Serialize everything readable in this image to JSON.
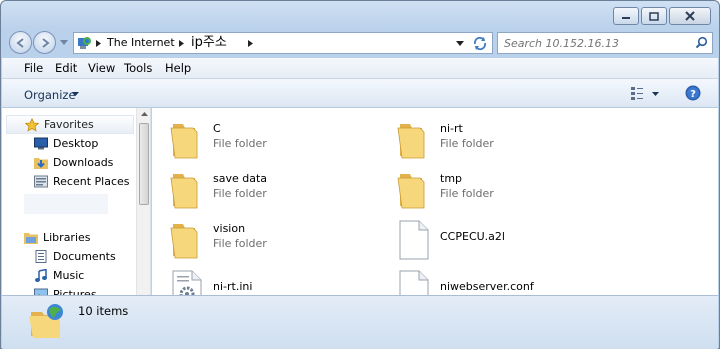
{
  "window": {
    "controls": [
      "minimize",
      "maximize",
      "close"
    ]
  },
  "address": {
    "crumbs": [
      "The Internet",
      "ip주소"
    ],
    "location_icon": "internet-globe-icon"
  },
  "search": {
    "placeholder": "Search 10.152.16.13"
  },
  "menu": {
    "items": [
      "File",
      "Edit",
      "View",
      "Tools",
      "Help"
    ]
  },
  "toolbar": {
    "organize_label": "Organize"
  },
  "nav": {
    "favorites": {
      "label": "Favorites",
      "items": [
        {
          "label": "Desktop",
          "icon": "desktop-icon"
        },
        {
          "label": "Downloads",
          "icon": "downloads-icon"
        },
        {
          "label": "Recent Places",
          "icon": "recent-places-icon"
        }
      ]
    },
    "libraries": {
      "label": "Libraries",
      "items": [
        {
          "label": "Documents",
          "icon": "documents-icon"
        },
        {
          "label": "Music",
          "icon": "music-icon"
        },
        {
          "label": "Pictures",
          "icon": "pictures-icon"
        }
      ]
    }
  },
  "files": [
    {
      "name": "C",
      "type": "File folder",
      "icon": "folder-icon"
    },
    {
      "name": "ni-rt",
      "type": "File folder",
      "icon": "folder-icon"
    },
    {
      "name": "save data",
      "type": "File folder",
      "icon": "folder-icon"
    },
    {
      "name": "tmp",
      "type": "File folder",
      "icon": "folder-icon"
    },
    {
      "name": "vision",
      "type": "File folder",
      "icon": "folder-icon"
    },
    {
      "name": "CCPECU.a2l",
      "type": "",
      "icon": "file-icon"
    },
    {
      "name": "ni-rt.ini",
      "type": "",
      "icon": "settings-file-icon"
    },
    {
      "name": "niwebserver.conf",
      "type": "",
      "icon": "file-icon"
    }
  ],
  "status": {
    "count_text": "10 items"
  }
}
